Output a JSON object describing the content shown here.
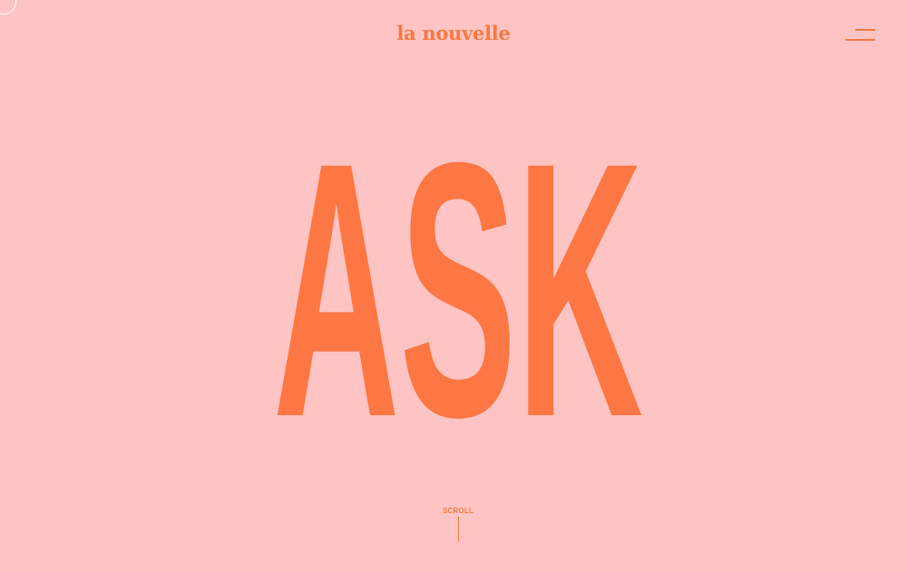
{
  "header": {
    "logo_text": "la nouvelle",
    "menu_icon": "hamburger-menu-icon"
  },
  "hero": {
    "headline": "ASK"
  },
  "scroll": {
    "label": "SCROLL"
  },
  "colors": {
    "background": "#fec3c3",
    "accent": "#fc7743",
    "logo": "#f47a42"
  }
}
